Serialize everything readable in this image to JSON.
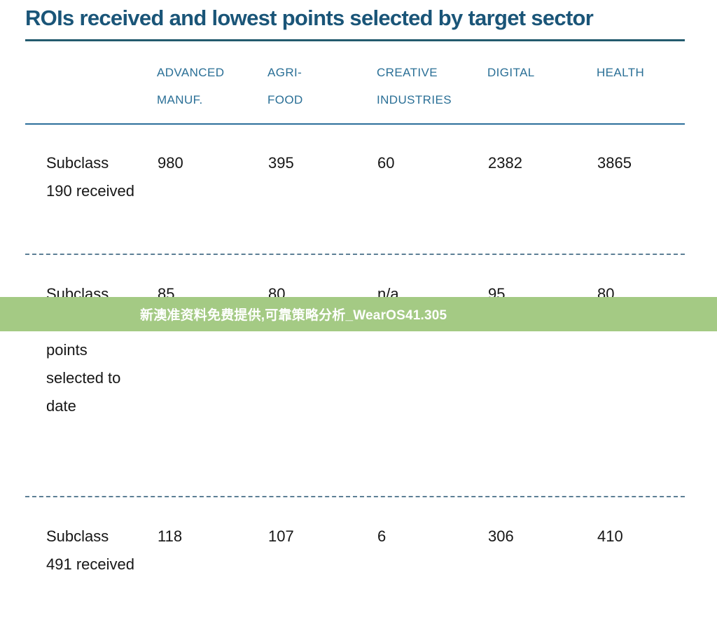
{
  "document": {
    "title": "ROIs received and lowest points selected by target sector"
  },
  "table": {
    "row_header_label": "",
    "columns": [
      {
        "line1": "ADVANCED",
        "line2": "MANUF."
      },
      {
        "line1": "AGRI-",
        "line2": "FOOD"
      },
      {
        "line1": "CREATIVE",
        "line2": "INDUSTRIES"
      },
      {
        "line1": "DIGITAL",
        "line2": ""
      },
      {
        "line1": "HEALTH",
        "line2": ""
      }
    ],
    "rows": [
      {
        "label": "Subclass 190 received",
        "values": [
          "980",
          "395",
          "60",
          "2382",
          "3865"
        ]
      },
      {
        "label": "Subclass 190 - Lowest points selected to date",
        "values": [
          "85",
          "80",
          "n/a",
          "95",
          "80"
        ]
      },
      {
        "label": "Subclass 491 received",
        "values": [
          "118",
          "107",
          "6",
          "306",
          "410"
        ]
      }
    ]
  },
  "watermark": {
    "text": "新澳准资料免费提供,可靠策略分析_WearOS41.305",
    "band_color": "#a4ca84",
    "text_color": "#ffffff"
  },
  "colors": {
    "title": "#1a5578",
    "column_header": "#2a6f96",
    "body_text": "#161616",
    "title_rule": "#235b6e",
    "header_rule": "#2c6f9b",
    "dashed_rule": "#5d7f95",
    "background": "#ffffff"
  },
  "chart_data": {
    "type": "table",
    "title": "ROIs received and lowest points selected by target sector",
    "categories": [
      "ADVANCED MANUF.",
      "AGRI-FOOD",
      "CREATIVE INDUSTRIES",
      "DIGITAL",
      "HEALTH"
    ],
    "series": [
      {
        "name": "Subclass 190 received",
        "values": [
          980,
          395,
          60,
          2382,
          3865
        ]
      },
      {
        "name": "Subclass 190 - Lowest points selected to date",
        "values": [
          85,
          80,
          null,
          95,
          80
        ]
      },
      {
        "name": "Subclass 491 received",
        "values": [
          118,
          107,
          6,
          306,
          410
        ]
      }
    ],
    "xlabel": "",
    "ylabel": "",
    "grid": false,
    "legend": "none"
  }
}
